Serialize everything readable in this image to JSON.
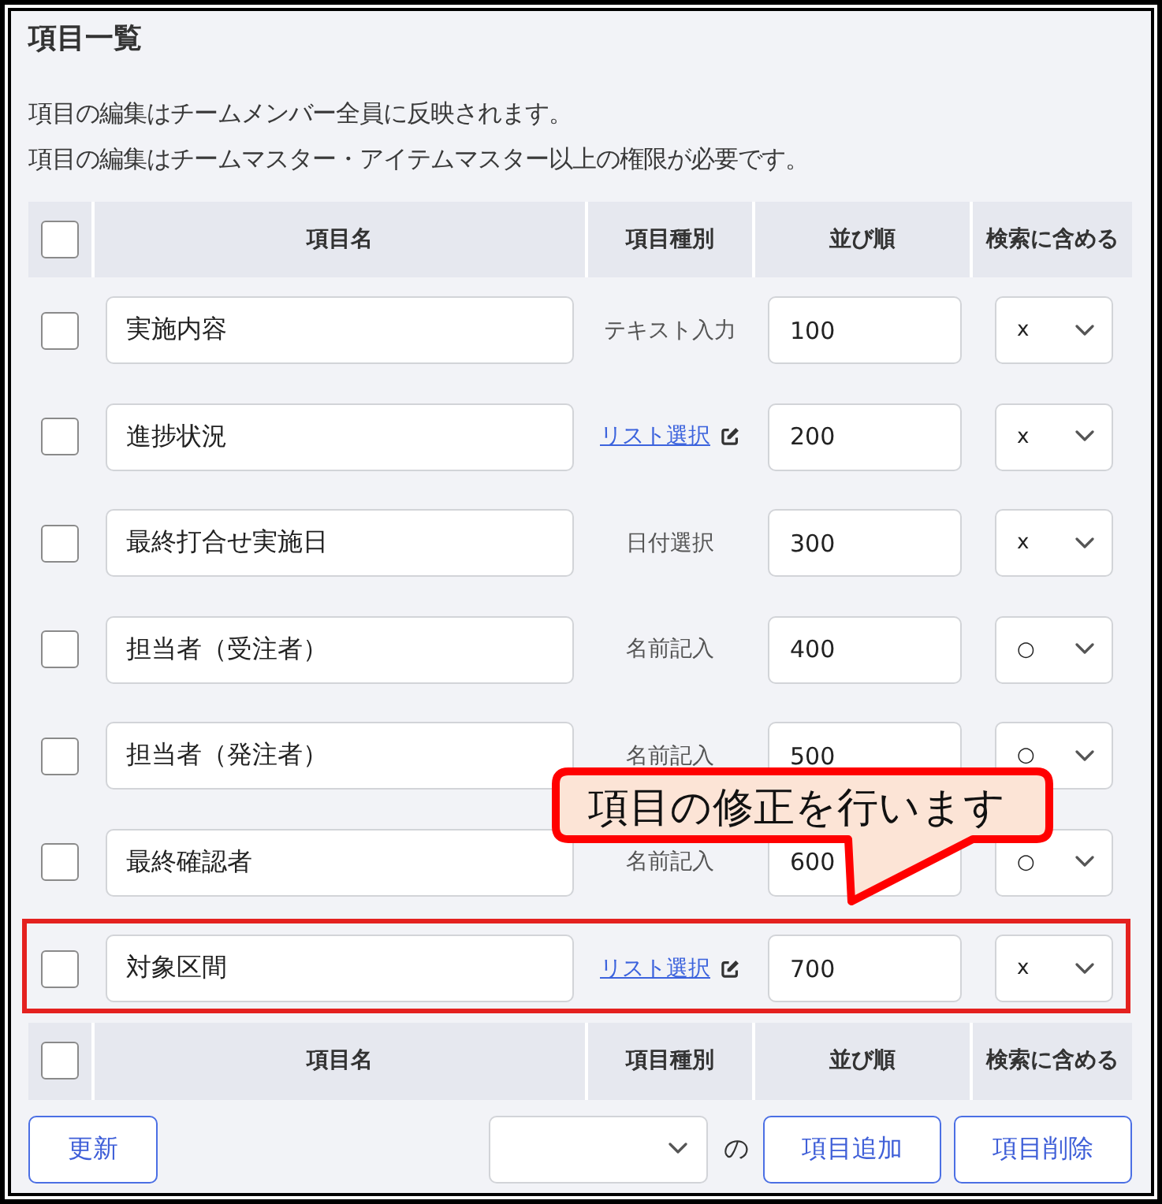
{
  "panel": {
    "title": "項目一覧",
    "notes": [
      "項目の編集はチームメンバー全員に反映されます。",
      "項目の編集はチームマスター・アイテムマスター以上の権限が必要です。"
    ]
  },
  "table": {
    "header": {
      "checked": false,
      "columns": [
        "項目名",
        "項目種別",
        "並び順",
        "検索に含める"
      ]
    },
    "rows": [
      {
        "checked": false,
        "name": "実施内容",
        "type": {
          "kind": "text",
          "label": "テキスト入力"
        },
        "order": "100",
        "search": "x",
        "highlighted": false
      },
      {
        "checked": false,
        "name": "進捗状況",
        "type": {
          "kind": "link",
          "label": "リスト選択"
        },
        "order": "200",
        "search": "x",
        "highlighted": false
      },
      {
        "checked": false,
        "name": "最終打合せ実施日",
        "type": {
          "kind": "text",
          "label": "日付選択"
        },
        "order": "300",
        "search": "x",
        "highlighted": false
      },
      {
        "checked": false,
        "name": "担当者（受注者）",
        "type": {
          "kind": "text",
          "label": "名前記入"
        },
        "order": "400",
        "search": "○",
        "highlighted": false
      },
      {
        "checked": false,
        "name": "担当者（発注者）",
        "type": {
          "kind": "text",
          "label": "名前記入"
        },
        "order": "500",
        "search": "○",
        "highlighted": false
      },
      {
        "checked": false,
        "name": "最終確認者",
        "type": {
          "kind": "text",
          "label": "名前記入"
        },
        "order": "600",
        "search": "○",
        "highlighted": false
      },
      {
        "checked": false,
        "name": "対象区間",
        "type": {
          "kind": "link",
          "label": "リスト選択"
        },
        "order": "700",
        "search": "x",
        "highlighted": true
      }
    ],
    "footer": {
      "checked": false,
      "columns": [
        "項目名",
        "項目種別",
        "並び順",
        "検索に含める"
      ]
    }
  },
  "actions": {
    "update": "更新",
    "joiner": "の",
    "add": "項目追加",
    "delete": "項目削除"
  },
  "callout": {
    "text": "項目の修正を行います"
  }
}
